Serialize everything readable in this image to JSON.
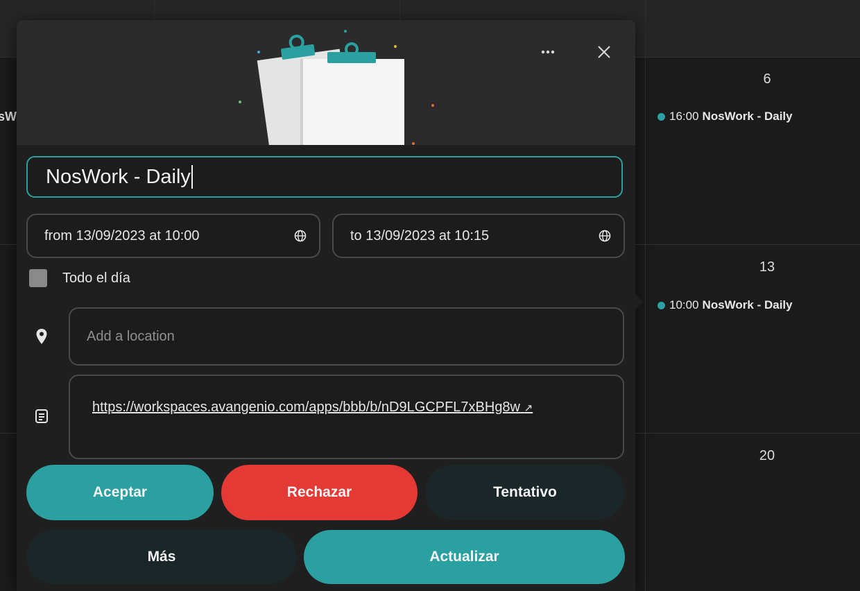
{
  "calendar": {
    "days": [
      "6",
      "13",
      "20"
    ],
    "events": [
      {
        "time": "16:00",
        "title": "NosWork - Daily"
      },
      {
        "time": "10:00",
        "title": "NosWork - Daily"
      }
    ],
    "cut_text": "sW",
    "event_dot_color": "#2aa1a0"
  },
  "popup": {
    "more_icon": "ellipsis-icon",
    "close_icon": "close-icon",
    "title_value": "NosWork - Daily",
    "start": "from 13/09/2023 at 10:00",
    "end": "to 13/09/2023 at 10:15",
    "timezone_icon": "globe-icon",
    "all_day_label": "Todo el día",
    "location_placeholder": "Add a location",
    "location_icon": "map-pin-icon",
    "description_icon": "notes-icon",
    "description_link": "https://workspaces.avangenio.com/apps/bbb/b/nD9LGCPFL7xBHg8w",
    "external_link_glyph": "↗",
    "buttons": {
      "accept": "Aceptar",
      "decline": "Rechazar",
      "tentative": "Tentativo",
      "more": "Más",
      "update": "Actualizar"
    }
  },
  "colors": {
    "accent": "#2aa1a0",
    "decline": "#e53935",
    "secondary": "#1a2627"
  }
}
